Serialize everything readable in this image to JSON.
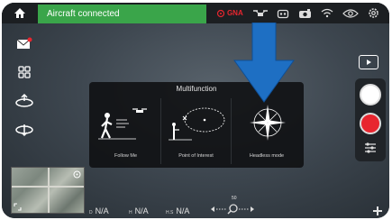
{
  "status_bar": {
    "connection_text": "Aircraft connected",
    "gps_label": "GNA",
    "icons": [
      "home-icon",
      "gps-icon",
      "drone-icon",
      "controller-icon",
      "camera-icon",
      "wifi-icon",
      "eye-icon",
      "gear-icon"
    ]
  },
  "left_controls": [
    "mail-icon",
    "grid-icon",
    "takeoff-icon",
    "landing-icon"
  ],
  "right_controls": [
    "video-playback-icon",
    "photo-shutter-icon",
    "record-icon",
    "settings-sliders-icon"
  ],
  "multifunction": {
    "title": "Multifunction",
    "options": [
      {
        "label": "Follow Me",
        "icon": "follow-me-icon"
      },
      {
        "label": "Point of Interest",
        "icon": "point-of-interest-icon"
      },
      {
        "label": "Headless mode",
        "icon": "headless-mode-icon"
      }
    ]
  },
  "highlight_arrow": {
    "color": "#1e6fc3"
  },
  "telemetry": {
    "d": {
      "key": "D",
      "value": "N/A"
    },
    "h": {
      "key": "H",
      "value": "N/A"
    },
    "hs": {
      "key": "H.S",
      "value": "N/A"
    }
  },
  "zoom": {
    "value": "50"
  },
  "colors": {
    "status_green": "#3aa54a",
    "record_red": "#e8262f",
    "panel_bg": "#0f1113"
  }
}
